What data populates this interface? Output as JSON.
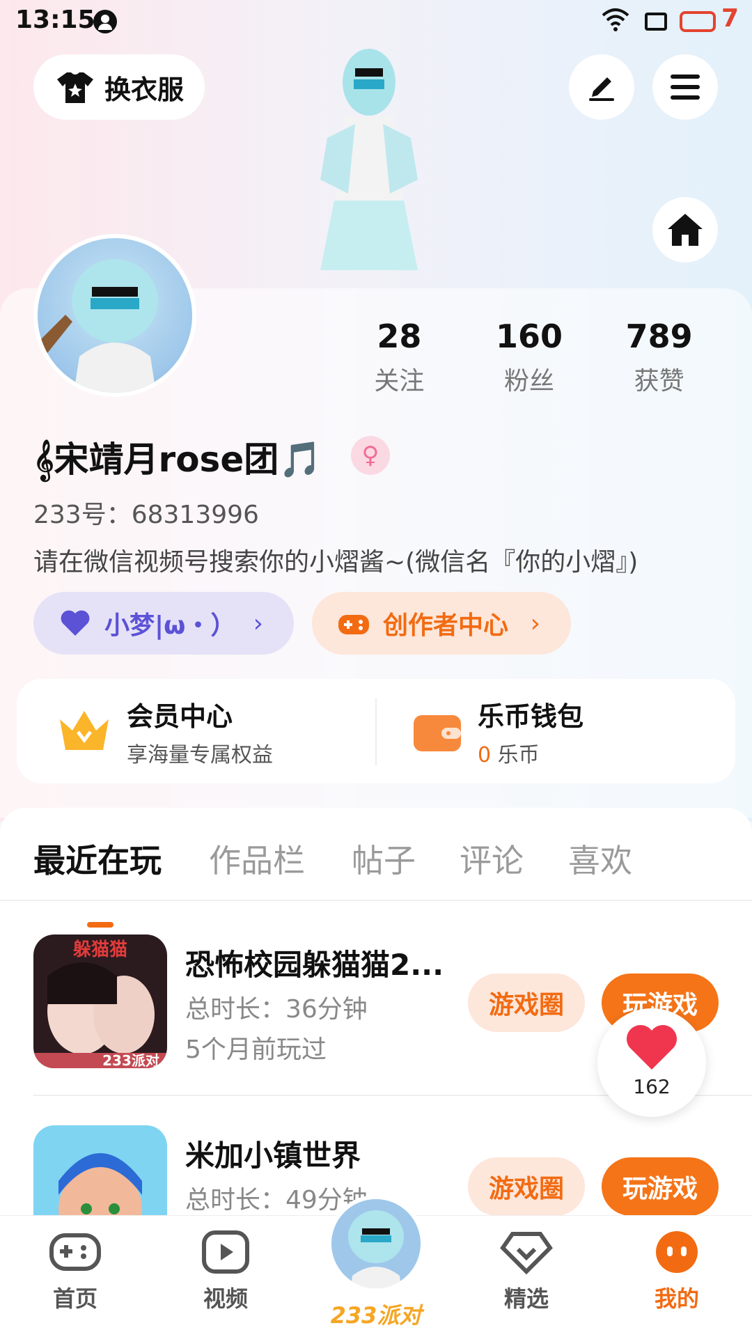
{
  "status_bar": {
    "time": "13:15",
    "battery": "7",
    "colors": {
      "battery": "#e3432f"
    }
  },
  "header": {
    "outfit_label": "换衣服",
    "icons": [
      "tshirt-icon",
      "edit-icon",
      "menu-icon",
      "home-icon"
    ]
  },
  "profile": {
    "stats": [
      {
        "value": "28",
        "label": "关注"
      },
      {
        "value": "160",
        "label": "粉丝"
      },
      {
        "value": "789",
        "label": "获赞"
      }
    ],
    "nickname": "𝄞宋靖月rose团🎵",
    "gender_symbol": "♀",
    "uid": "233号：68313996",
    "bio": "请在微信视频号搜索你的小熠酱~(微信名『你的小熠』)",
    "dream_pill": "小梦|ω・）",
    "creator_pill": "创作者中心",
    "chevron": "›"
  },
  "vip": {
    "member_title": "会员中心",
    "member_sub": "享海量专属权益",
    "wallet_title": "乐币钱包",
    "wallet_amount": "0",
    "wallet_unit": " 乐币"
  },
  "tabs": [
    "最近在玩",
    "作品栏",
    "帖子",
    "评论",
    "喜欢"
  ],
  "games": [
    {
      "title": "恐怖校园躲猫猫2...",
      "duration": "总时长：36分钟",
      "last_played": "5个月前玩过",
      "icon_text": "躲猫猫",
      "icon_badge": "233派对",
      "circle_btn": "游戏圈",
      "play_btn": "玩游戏"
    },
    {
      "title": "米加小镇世界",
      "duration": "总时长：49分钟",
      "circle_btn": "游戏圈",
      "play_btn": "玩游戏"
    }
  ],
  "like_float": {
    "count": "162"
  },
  "bottom_nav": [
    {
      "label": "首页",
      "icon": "gamepad-icon"
    },
    {
      "label": "视频",
      "icon": "video-icon"
    },
    {
      "label": "233派对",
      "icon": "avatar"
    },
    {
      "label": "精选",
      "icon": "heart-diamond-icon"
    },
    {
      "label": "我的",
      "icon": "face-icon"
    }
  ],
  "colors": {
    "accent": "#f26b12",
    "dream": "#5b52d6"
  }
}
